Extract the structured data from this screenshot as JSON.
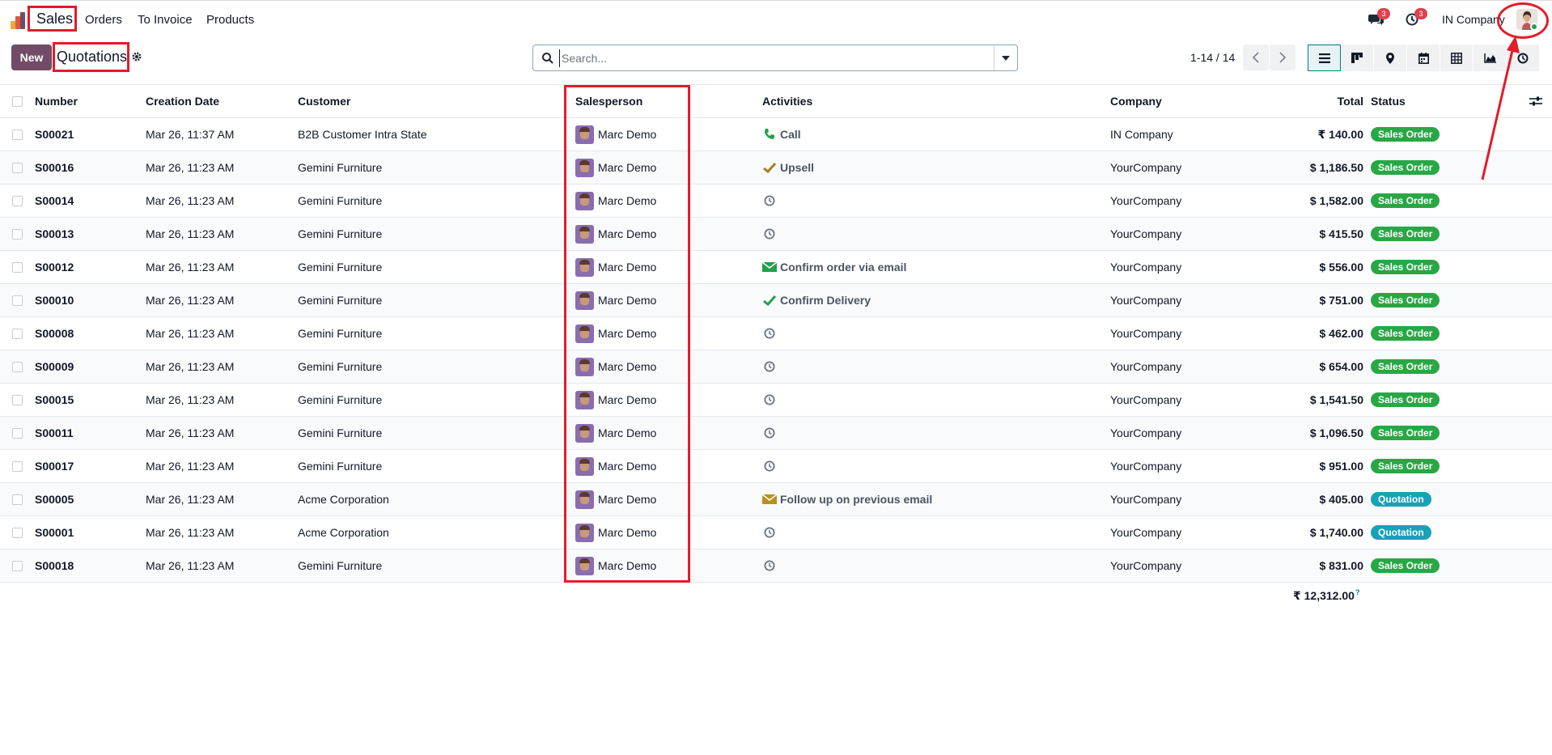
{
  "navbar": {
    "app_name": "Sales",
    "menu": [
      "Orders",
      "To Invoice",
      "Products"
    ],
    "messages_count": "3",
    "activities_count": "3",
    "company": "IN Company"
  },
  "control_panel": {
    "new_label": "New",
    "title": "Quotations",
    "search_placeholder": "Search...",
    "pager": "1-14 / 14"
  },
  "table": {
    "columns": {
      "number": "Number",
      "creation_date": "Creation Date",
      "customer": "Customer",
      "salesperson": "Salesperson",
      "activities": "Activities",
      "company": "Company",
      "total": "Total",
      "status": "Status"
    },
    "rows": [
      {
        "number": "S00021",
        "date": "Mar 26, 11:37 AM",
        "customer": "B2B Customer Intra State",
        "salesperson": "Marc Demo",
        "activity_icon": "phone-icon",
        "activity": "Call",
        "company": "IN Company",
        "total": "₹ 140.00",
        "status": "Sales Order",
        "status_type": "so"
      },
      {
        "number": "S00016",
        "date": "Mar 26, 11:23 AM",
        "customer": "Gemini Furniture",
        "salesperson": "Marc Demo",
        "activity_icon": "check-gold-icon",
        "activity": "Upsell",
        "company": "YourCompany",
        "total": "$ 1,186.50",
        "status": "Sales Order",
        "status_type": "so"
      },
      {
        "number": "S00014",
        "date": "Mar 26, 11:23 AM",
        "customer": "Gemini Furniture",
        "salesperson": "Marc Demo",
        "activity_icon": "clock-icon",
        "activity": "",
        "company": "YourCompany",
        "total": "$ 1,582.00",
        "status": "Sales Order",
        "status_type": "so"
      },
      {
        "number": "S00013",
        "date": "Mar 26, 11:23 AM",
        "customer": "Gemini Furniture",
        "salesperson": "Marc Demo",
        "activity_icon": "clock-icon",
        "activity": "",
        "company": "YourCompany",
        "total": "$ 415.50",
        "status": "Sales Order",
        "status_type": "so"
      },
      {
        "number": "S00012",
        "date": "Mar 26, 11:23 AM",
        "customer": "Gemini Furniture",
        "salesperson": "Marc Demo",
        "activity_icon": "envelope-green-icon",
        "activity": "Confirm order via email",
        "company": "YourCompany",
        "total": "$ 556.00",
        "status": "Sales Order",
        "status_type": "so"
      },
      {
        "number": "S00010",
        "date": "Mar 26, 11:23 AM",
        "customer": "Gemini Furniture",
        "salesperson": "Marc Demo",
        "activity_icon": "check-green-icon",
        "activity": "Confirm Delivery",
        "company": "YourCompany",
        "total": "$ 751.00",
        "status": "Sales Order",
        "status_type": "so"
      },
      {
        "number": "S00008",
        "date": "Mar 26, 11:23 AM",
        "customer": "Gemini Furniture",
        "salesperson": "Marc Demo",
        "activity_icon": "clock-icon",
        "activity": "",
        "company": "YourCompany",
        "total": "$ 462.00",
        "status": "Sales Order",
        "status_type": "so"
      },
      {
        "number": "S00009",
        "date": "Mar 26, 11:23 AM",
        "customer": "Gemini Furniture",
        "salesperson": "Marc Demo",
        "activity_icon": "clock-icon",
        "activity": "",
        "company": "YourCompany",
        "total": "$ 654.00",
        "status": "Sales Order",
        "status_type": "so"
      },
      {
        "number": "S00015",
        "date": "Mar 26, 11:23 AM",
        "customer": "Gemini Furniture",
        "salesperson": "Marc Demo",
        "activity_icon": "clock-icon",
        "activity": "",
        "company": "YourCompany",
        "total": "$ 1,541.50",
        "status": "Sales Order",
        "status_type": "so"
      },
      {
        "number": "S00011",
        "date": "Mar 26, 11:23 AM",
        "customer": "Gemini Furniture",
        "salesperson": "Marc Demo",
        "activity_icon": "clock-icon",
        "activity": "",
        "company": "YourCompany",
        "total": "$ 1,096.50",
        "status": "Sales Order",
        "status_type": "so"
      },
      {
        "number": "S00017",
        "date": "Mar 26, 11:23 AM",
        "customer": "Gemini Furniture",
        "salesperson": "Marc Demo",
        "activity_icon": "clock-icon",
        "activity": "",
        "company": "YourCompany",
        "total": "$ 951.00",
        "status": "Sales Order",
        "status_type": "so"
      },
      {
        "number": "S00005",
        "date": "Mar 26, 11:23 AM",
        "customer": "Acme Corporation",
        "salesperson": "Marc Demo",
        "activity_icon": "envelope-gold-icon",
        "activity": "Follow up on previous email",
        "company": "YourCompany",
        "total": "$ 405.00",
        "status": "Quotation",
        "status_type": "qt"
      },
      {
        "number": "S00001",
        "date": "Mar 26, 11:23 AM",
        "customer": "Acme Corporation",
        "salesperson": "Marc Demo",
        "activity_icon": "clock-icon",
        "activity": "",
        "company": "YourCompany",
        "total": "$ 1,740.00",
        "status": "Quotation",
        "status_type": "qt"
      },
      {
        "number": "S00018",
        "date": "Mar 26, 11:23 AM",
        "customer": "Gemini Furniture",
        "salesperson": "Marc Demo",
        "activity_icon": "clock-icon",
        "activity": "",
        "company": "YourCompany",
        "total": "$ 831.00",
        "status": "Sales Order",
        "status_type": "so"
      }
    ],
    "grand_total": "₹ 12,312.00",
    "grand_total_help": "?"
  },
  "colors": {
    "brand": "#714b67",
    "annotation": "#e11d2a",
    "sales_order": "#28a745",
    "quotation": "#17a2b8"
  }
}
